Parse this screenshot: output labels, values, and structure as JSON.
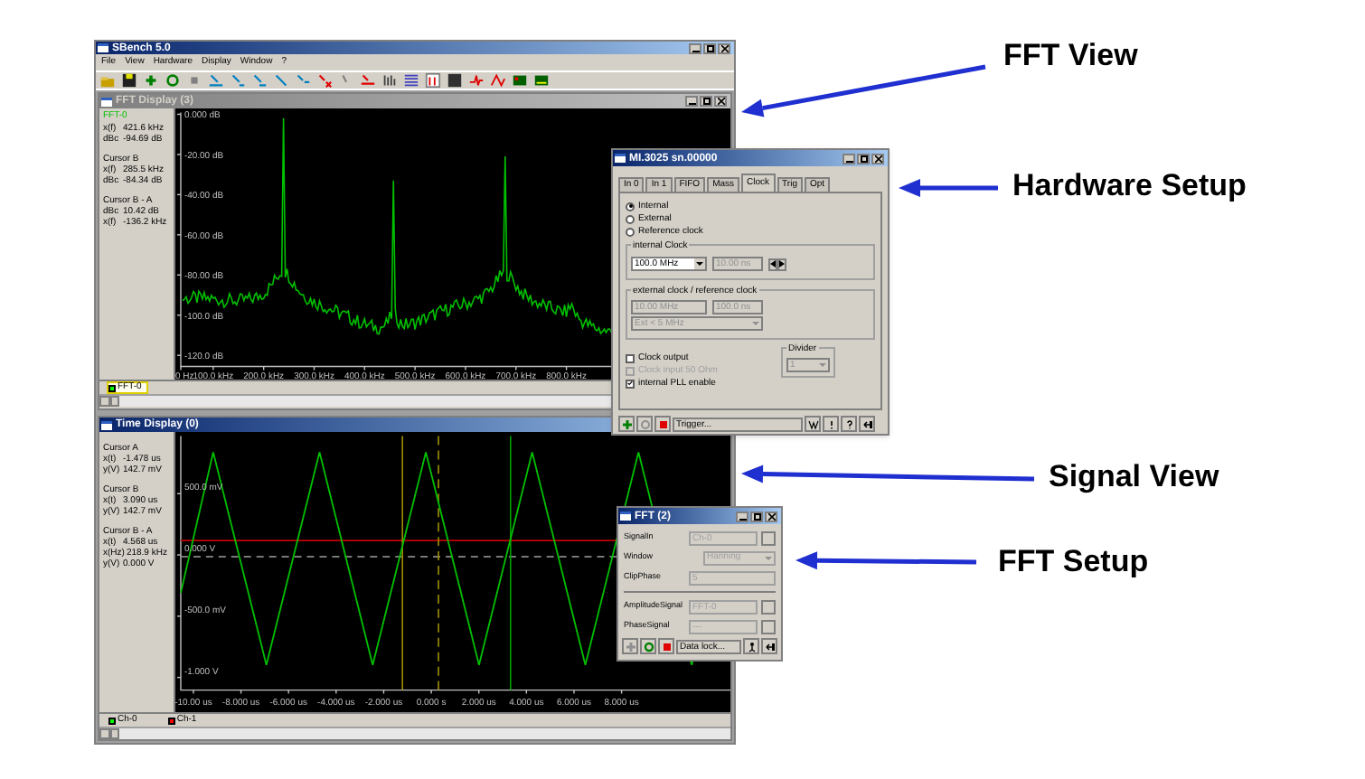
{
  "annotations": [
    {
      "text": "FFT View"
    },
    {
      "text": "Hardware Setup"
    },
    {
      "text": "Signal View"
    },
    {
      "text": "FFT Setup"
    }
  ],
  "app": {
    "title": "SBench 5.0",
    "menu": [
      "File",
      "View",
      "Hardware",
      "Display",
      "Window",
      "?"
    ],
    "fft_display": {
      "title": "FFT Display (3)",
      "active": false,
      "cursor_info": [
        {
          "kind": "signal",
          "text": "FFT-0"
        },
        {
          "kind": "value",
          "label": "x(f)",
          "value": "421.6 kHz"
        },
        {
          "kind": "value",
          "label": "dBc",
          "value": "-94.69 dB"
        },
        {
          "kind": "heading",
          "text": "Cursor B"
        },
        {
          "kind": "value",
          "label": "x(f)",
          "value": "285.5 kHz"
        },
        {
          "kind": "value",
          "label": "dBc",
          "value": "-84.34 dB"
        },
        {
          "kind": "heading",
          "text": "Cursor B - A"
        },
        {
          "kind": "value",
          "label": "dBc",
          "value": "10.42 dB"
        },
        {
          "kind": "value",
          "label": "x(f)",
          "value": "-136.2 kHz"
        }
      ],
      "y_ticks": [
        "0.000 dB",
        "-20.00 dB",
        "-40.00 dB",
        "-60.00 dB",
        "-80.00 dB",
        "-100.0 dB",
        "-120.0 dB"
      ],
      "x_ticks": [
        "0 Hz",
        "100.0 kHz",
        "200.0 kHz",
        "300.0 kHz",
        "400.0 kHz",
        "500.0 kHz",
        "600.0 kHz",
        "700.0 kHz",
        "800.0 kHz"
      ],
      "legend": [
        {
          "label": "FFT-0",
          "color": "#00ff00",
          "selected": true
        }
      ]
    },
    "time_display": {
      "title": "Time Display (0)",
      "active": true,
      "cursor_info": [
        {
          "kind": "heading",
          "text": "Cursor A"
        },
        {
          "kind": "value",
          "label": "x(t)",
          "value": "-1.478 us"
        },
        {
          "kind": "value",
          "label": "y(V)",
          "value": "142.7 mV"
        },
        {
          "kind": "heading",
          "text": "Cursor B"
        },
        {
          "kind": "value",
          "label": "x(t)",
          "value": "3.090 us"
        },
        {
          "kind": "value",
          "label": "y(V)",
          "value": "142.7 mV"
        },
        {
          "kind": "heading",
          "text": "Cursor B - A"
        },
        {
          "kind": "value",
          "label": "x(t)",
          "value": "4.568 us"
        },
        {
          "kind": "value",
          "label": "x(Hz)",
          "value": "218.9 kHz"
        },
        {
          "kind": "value",
          "label": "y(V)",
          "value": "0.000 V"
        }
      ],
      "y_ticks": [
        "500.0 mV",
        "0.000 V",
        "-500.0 mV",
        "-1.000 V"
      ],
      "x_ticks": [
        "-10.00 us",
        "-8.000 us",
        "-6.000 us",
        "-4.000 us",
        "-2.000 us",
        "0.000 s",
        "2.000 us",
        "4.000 us",
        "6.000 us",
        "8.000 us"
      ],
      "legend": [
        {
          "label": "Ch-0",
          "color": "#00ff00",
          "selected": false
        },
        {
          "label": "Ch-1",
          "color": "#ff0000",
          "selected": false
        }
      ]
    }
  },
  "hardware_dialog": {
    "title": "MI.3025 sn.00000",
    "tabs": [
      {
        "label": "In 0",
        "selected": false
      },
      {
        "label": "In 1",
        "selected": false
      },
      {
        "label": "FIFO",
        "selected": false
      },
      {
        "label": "Mass",
        "selected": false
      },
      {
        "label": "Clock",
        "selected": true
      },
      {
        "label": "Trig",
        "selected": false
      },
      {
        "label": "Opt",
        "selected": false
      }
    ],
    "clock_source": [
      {
        "label": "Internal",
        "selected": true
      },
      {
        "label": "External",
        "selected": false
      },
      {
        "label": "Reference clock",
        "selected": false
      }
    ],
    "internal_clock": {
      "title": "internal Clock",
      "rate": {
        "value": "100.0 MHz",
        "disabled": false
      },
      "period": {
        "value": "10.00 ns",
        "disabled": true
      }
    },
    "external_clock": {
      "title": "external clock / reference clock",
      "rate": {
        "value": "10.00 MHz",
        "disabled": true
      },
      "period": {
        "value": "100.0 ns",
        "disabled": true
      },
      "range": {
        "value": "Ext < 5 MHz",
        "disabled": true
      }
    },
    "options": [
      {
        "label": "Clock output",
        "checked": false,
        "disabled": false
      },
      {
        "label": "Clock input 50 Ohm",
        "checked": false,
        "disabled": true
      },
      {
        "label": "internal PLL enable",
        "checked": true,
        "disabled": false
      }
    ],
    "divider": {
      "title": "Divider",
      "value": "1",
      "disabled": true
    },
    "status_field": "Trigger..."
  },
  "fft_dialog": {
    "title": "FFT (2)",
    "rows": [
      {
        "label": "SignalIn",
        "kind": "field_button",
        "value": "Ch-0"
      },
      {
        "label": "Window",
        "kind": "dropdown",
        "value": "Hanning"
      },
      {
        "label": "ClipPhase",
        "kind": "field",
        "value": "5"
      },
      {
        "label": "AmplitudeSignal",
        "kind": "field_button",
        "value": "FFT-0"
      },
      {
        "label": "PhaseSignal",
        "kind": "field_button",
        "value": "---"
      }
    ],
    "status_field": "Data lock..."
  }
}
